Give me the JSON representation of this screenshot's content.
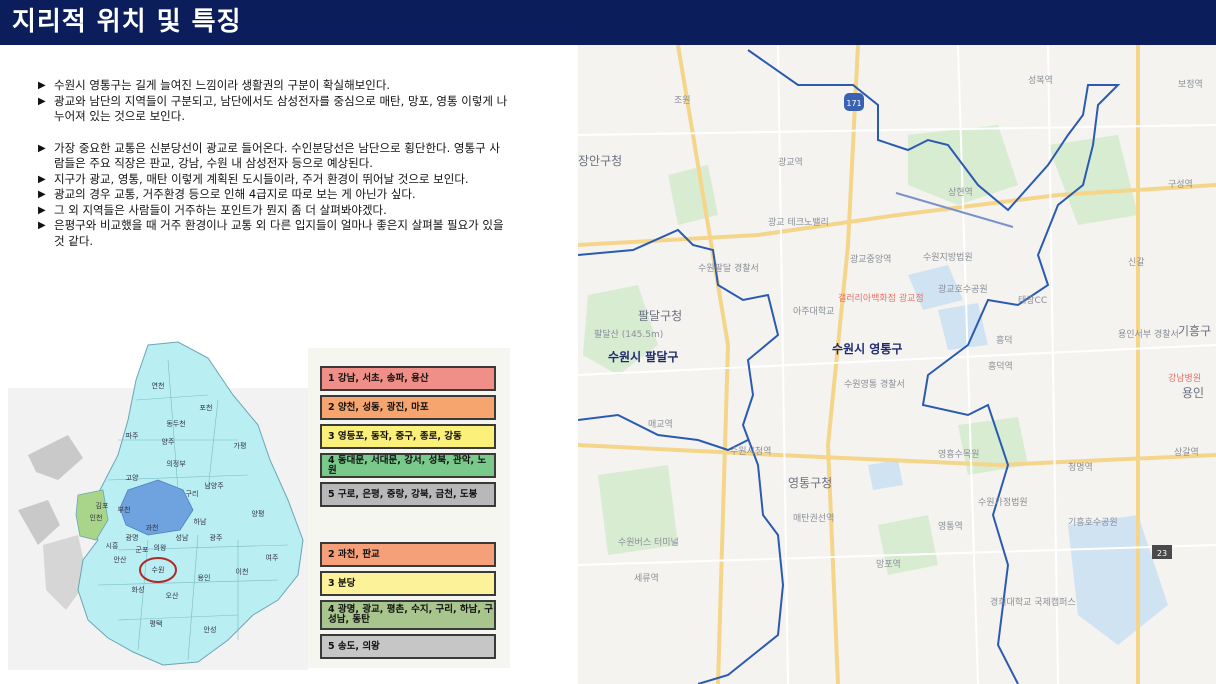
{
  "header": {
    "title": "지리적 위치 및 특징"
  },
  "bullets": {
    "group1": [
      "수원시 영통구는 길게 늘여진 느낌이라 생활권의 구분이 확실해보인다.",
      "광교와 남단의 지역들이 구분되고, 남단에서도 삼성전자를 중심으로 매탄, 망포, 영통 이렇게 나누어져 있는 것으로 보인다."
    ],
    "group2": [
      "가장 중요한 교통은 신분당선이 광교로 들어온다. 수인분당선은 남단으로 횡단한다. 영통구 사람들은 주요 직장은 판교, 강남, 수원 내 삼성전자 등으로 예상된다.",
      "지구가 광교, 영통, 매탄 이렇게 계획된 도시들이라, 주거 환경이 뛰어날 것으로 보인다.",
      "광교의 경우 교통, 거주환경 등으로 인해 4급지로 따로 보는 게 아닌가 싶다.",
      "그 외 지역들은 사람들이 거주하는 포인트가 뭔지 좀 더 살펴봐야겠다.",
      "은평구와 비교했을 때 거주 환경이나 교통 외 다른 입지들이 얼마나 좋은지 살펴볼 필요가 있을 것 같다."
    ],
    "marker": "▶"
  },
  "gyeonggi_map": {
    "labels": [
      "연천",
      "포천",
      "파주",
      "동두천",
      "양주",
      "가평",
      "의정부",
      "고양",
      "남양주",
      "구리",
      "김포",
      "부천",
      "인천",
      "하남",
      "양평",
      "광명",
      "성남",
      "시흥",
      "안산",
      "과천",
      "의왕",
      "광주",
      "군포",
      "수원",
      "용인",
      "이천",
      "여주",
      "화성",
      "오산",
      "평택",
      "안성"
    ],
    "highlight": "수원",
    "colors": {
      "land": "#b9eef2",
      "seoul": "#6fa3e0",
      "incheon": "#a9d58a",
      "circle": "#b02a2a"
    }
  },
  "legend": {
    "seoul_tiers": [
      {
        "label": "1 강남, 서초, 송파, 용산",
        "color": "#ef8f87"
      },
      {
        "label": "2 양천, 성동, 광진, 마포",
        "color": "#f6a56f"
      },
      {
        "label": "3 영등포, 동작, 중구, 종로, 강동",
        "color": "#fbf07a"
      },
      {
        "label": "4 동대문, 서대문, 강서, 성북, 관악, 노원",
        "color": "#79c98b"
      },
      {
        "label": "5 구로, 은평, 중랑, 강북, 금천, 도봉",
        "color": "#b8b8b8"
      }
    ],
    "gyeonggi_tiers": [
      {
        "label": "2 과천, 판교",
        "color": "#f6a07a"
      },
      {
        "label": "3 분당",
        "color": "#fbf29a"
      },
      {
        "label": "4 광명, 광교, 평촌, 수지, 구리, 하남, 구성남, 동탄",
        "color": "#a7c58c"
      },
      {
        "label": "5 송도, 의왕",
        "color": "#c6c6c6"
      }
    ]
  },
  "suwon_map": {
    "districts": {
      "yeongtong": "수원시 영통구",
      "paldal": "수원시 팔달구"
    },
    "places": {
      "jangan": "장안구청",
      "paldal_office": "팔달구청",
      "yeongtong_office": "영통구청",
      "gwanggyo_station": "광교역",
      "sanghyeon": "상현역",
      "gwanggyo_jungang": "광교중앙역",
      "gwanggyo_lake": "광교호수공원",
      "ajou": "아주대학교",
      "court": "수원지방법원",
      "heungdeok": "흥덕",
      "yeongtong_station": "영통역",
      "mangpo": "망포역",
      "maetan": "매탄권선역",
      "maegyo": "매교역",
      "suwon_city_hall": "수원시청역",
      "cheongmyeong": "청명역",
      "family_court": "수원가정법원",
      "yeongheung": "영흥수목원",
      "kyunghee": "경희대학교 국제캠퍼스",
      "sinmanpo": "세류역",
      "paldalsan": "팔달산 (145.5m)",
      "gihung": "기흥구",
      "yongin": "용인",
      "singal": "신갈",
      "taegueong": "태광CC",
      "yeongtong_police": "수원영통 경찰서",
      "paldal_police": "수원팔달 경찰서",
      "suwon_bus": "수원버스 터미널",
      "gihung_lake": "기흥호수공원",
      "sanghyeon_station": "상현역",
      "bojeong": "보정역",
      "seongbuk": "성복역",
      "guseong": "구성역",
      "gallery": "갤러리아백화점 광교점",
      "gangnam_hospital": "강남병원",
      "yongin_police": "용인서부 경찰서",
      "jowon": "조원",
      "sangal": "상갈역",
      "heungdeok_school": "흥덕역",
      "kwanggyo_techno": "광교 테크노밸리",
      "road_171": "171",
      "road_23": "23"
    },
    "colors": {
      "boundary": "#2a5bb0",
      "road": "#f5d58a",
      "water": "#cfe3f3",
      "green": "#d8ecd2",
      "base": "#f4f3ef"
    }
  }
}
